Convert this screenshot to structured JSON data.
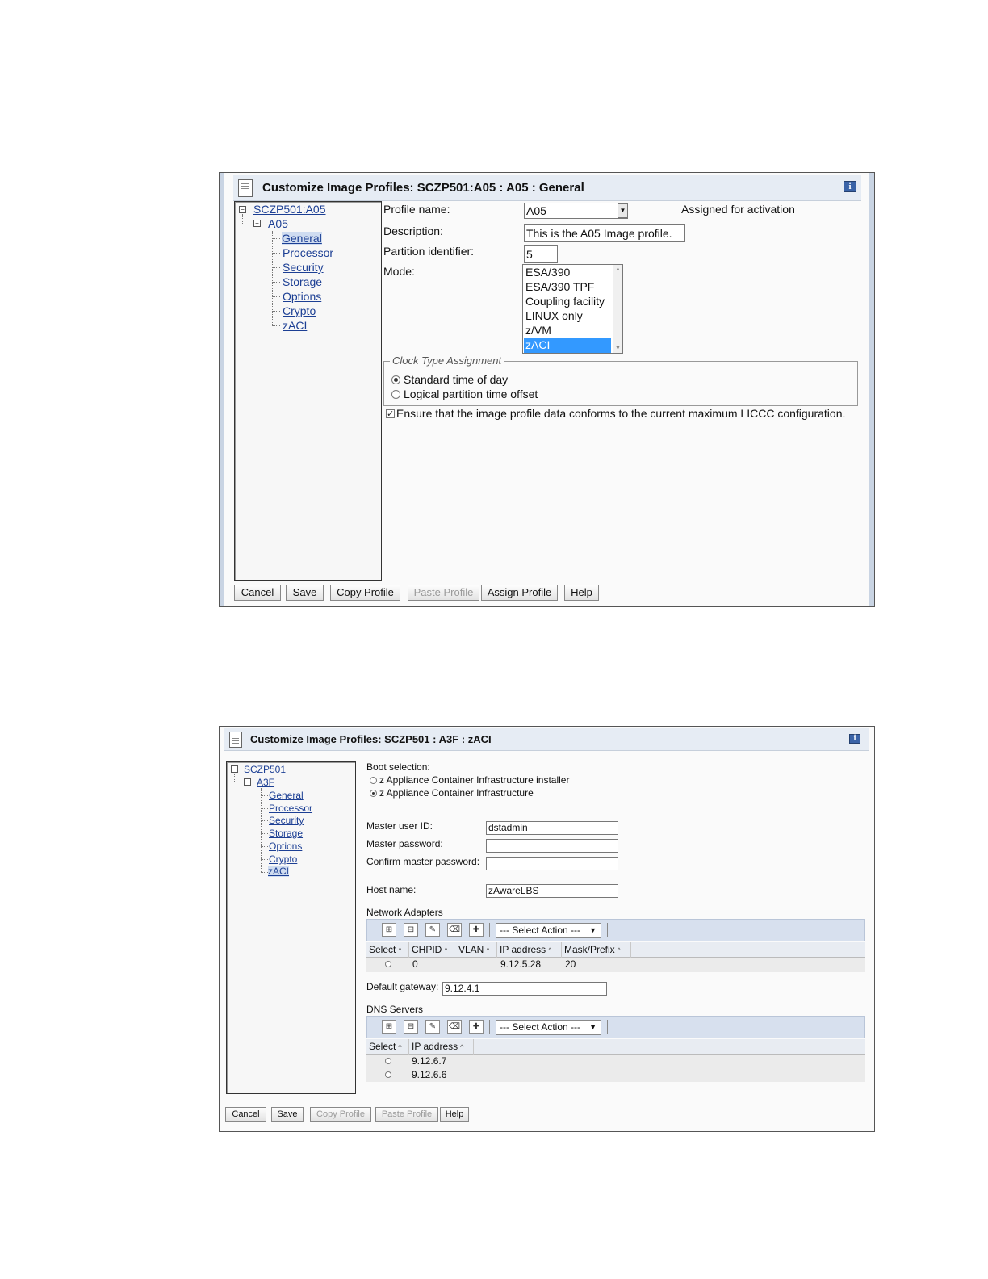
{
  "colors": {
    "link": "#1c3f94",
    "title_bg": "#e6ecf4",
    "selected_option": "#3399ff",
    "toolbar_bg": "#d7e0ee"
  },
  "w1": {
    "title": "Customize Image Profiles: SCZP501:A05 : A05 : General",
    "info_icon": "i",
    "tree": {
      "root": "SCZP501:A05",
      "child": "A05",
      "items": [
        "General",
        "Processor",
        "Security",
        "Storage",
        "Options",
        "Crypto",
        "zACI"
      ]
    },
    "profile_name_label": "Profile name:",
    "profile_name_value": "A05",
    "assigned_text": "Assigned for activation",
    "description_label": "Description:",
    "description_value": "This is the A05 Image profile.",
    "partition_label": "Partition identifier:",
    "partition_value": "5",
    "mode_label": "Mode:",
    "mode_options": [
      "ESA/390",
      "ESA/390 TPF",
      "Coupling facility",
      "LINUX only",
      "z/VM",
      "zACI"
    ],
    "mode_selected": "zACI",
    "clock_legend": "Clock Type Assignment",
    "clock_options": [
      "Standard time of day",
      "Logical partition time offset"
    ],
    "clock_selected": "Standard time of day",
    "ensure_text": "Ensure that the image profile data conforms to the current maximum LICCC configuration.",
    "ensure_checked": true,
    "buttons": [
      "Cancel",
      "Save",
      "Copy Profile",
      "Paste Profile",
      "Assign Profile",
      "Help"
    ],
    "disabled_buttons": [
      "Paste Profile"
    ]
  },
  "w2": {
    "title": "Customize Image Profiles: SCZP501 : A3F : zACI",
    "info_icon": "i",
    "tree": {
      "root": "SCZP501",
      "child": "A3F",
      "items": [
        "General",
        "Processor",
        "Security",
        "Storage",
        "Options",
        "Crypto",
        "zACI"
      ]
    },
    "boot_label": "Boot selection:",
    "boot_options": [
      "z Appliance Container Infrastructure installer",
      "z Appliance Container Infrastructure"
    ],
    "boot_selected": "z Appliance Container Infrastructure",
    "master_user_label": "Master user ID:",
    "master_user_value": "dstadmin",
    "master_password_label": "Master password:",
    "confirm_password_label": "Confirm master password:",
    "host_label": "Host name:",
    "host_value": "zAwareLBS",
    "network_label": "Network Adapters",
    "select_action": "--- Select Action ---",
    "network_columns": [
      "Select",
      "CHPID",
      "VLAN",
      "IP address",
      "Mask/Prefix"
    ],
    "network_rows": [
      {
        "chpid": "0",
        "vlan": "",
        "ip": "9.12.5.28",
        "mask": "20"
      }
    ],
    "gateway_label": "Default gateway:",
    "gateway_value": "9.12.4.1",
    "dns_label": "DNS Servers",
    "dns_columns": [
      "Select",
      "IP address"
    ],
    "dns_rows": [
      "9.12.6.7",
      "9.12.6.6"
    ],
    "toolbar_icons": [
      "select-all-icon",
      "deselect-all-icon",
      "edit-icon",
      "clear-icon",
      "add-icon"
    ],
    "buttons": [
      "Cancel",
      "Save",
      "Copy Profile",
      "Paste Profile",
      "Help"
    ],
    "disabled_buttons": [
      "Copy Profile",
      "Paste Profile"
    ]
  }
}
